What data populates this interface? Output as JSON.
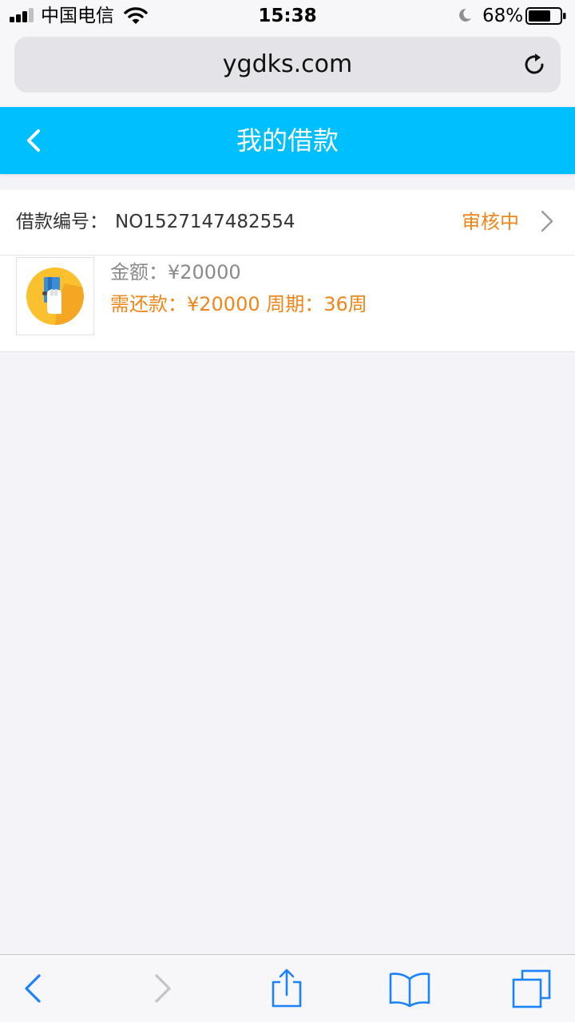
{
  "status_bar": {
    "carrier": "中国电信",
    "time": "15:38",
    "battery": "68%"
  },
  "browser": {
    "url": "ygdks.com"
  },
  "header": {
    "title": "我的借款"
  },
  "loan": {
    "number_label": "借款编号：",
    "number_value": "NO1527147482554",
    "status": "审核中",
    "amount_text": "金额：¥20000",
    "repay_text": "需还款：¥20000 周期：36周"
  },
  "colors": {
    "header_bg": "#00bfff",
    "status_orange": "#f08519",
    "toolbar_blue": "#1a82fb"
  },
  "icons": {
    "status_bar": [
      "signal-icon",
      "wifi-icon",
      "moon-icon",
      "battery-icon"
    ],
    "browser": [
      "reload-icon"
    ],
    "header": [
      "back-arrow-icon"
    ],
    "loan": [
      "chevron-right-icon",
      "credit-card-icon"
    ],
    "toolbar": [
      "back-icon",
      "forward-icon",
      "share-icon",
      "bookmarks-icon",
      "tabs-icon"
    ]
  }
}
